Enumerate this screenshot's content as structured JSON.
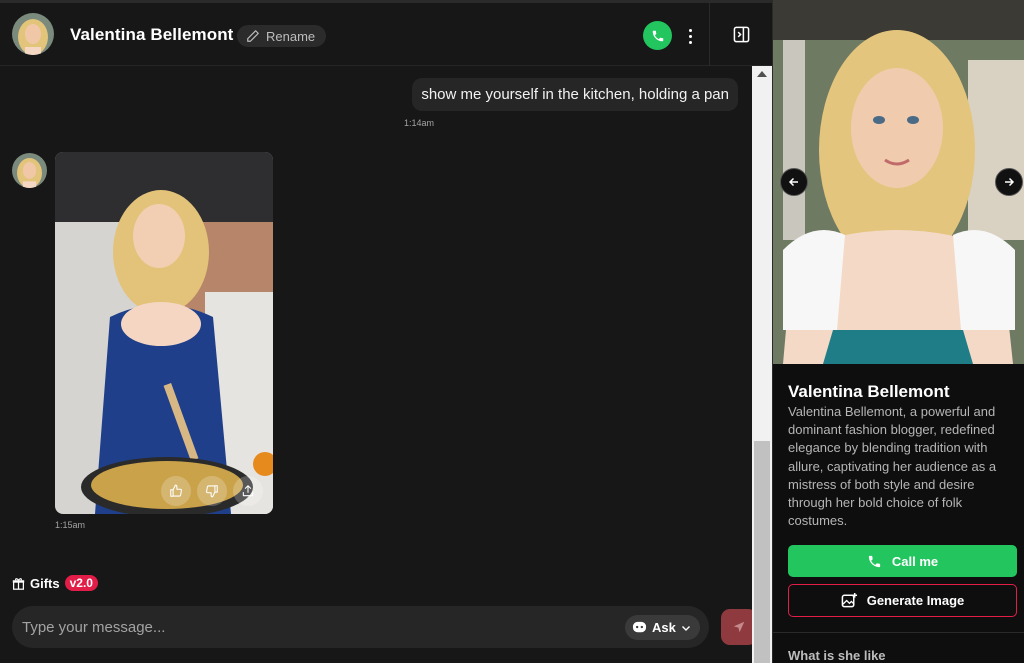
{
  "header": {
    "name": "Valentina Bellemont",
    "rename_label": "Rename"
  },
  "messages": {
    "user_text": "show me yourself in the kitchen, holding a pan",
    "user_time": "1:14am",
    "bot_time": "1:15am"
  },
  "composer": {
    "gifts_label": "Gifts",
    "gifts_badge": "v2.0",
    "placeholder": "Type your message...",
    "ask_label": "Ask"
  },
  "profile": {
    "name": "Valentina Bellemont",
    "bio": "Valentina Bellemont, a powerful and dominant fashion blogger, redefined elegance by blending tradition with allure, captivating her audience as a mistress of both style and desire through her bold choice of folk costumes.",
    "call_label": "Call me",
    "generate_label": "Generate Image",
    "section_title": "What is she like"
  },
  "colors": {
    "accent_green": "#22c55e",
    "accent_red": "#e11d48",
    "background": "#171717"
  },
  "icons": [
    "pencil-icon",
    "phone-icon",
    "more-vertical-icon",
    "side-panel-icon",
    "thumbs-up-icon",
    "thumbs-down-icon",
    "share-icon",
    "gift-icon",
    "chevron-down-icon",
    "send-icon",
    "arrow-left-icon",
    "arrow-right-icon",
    "image-plus-icon"
  ]
}
